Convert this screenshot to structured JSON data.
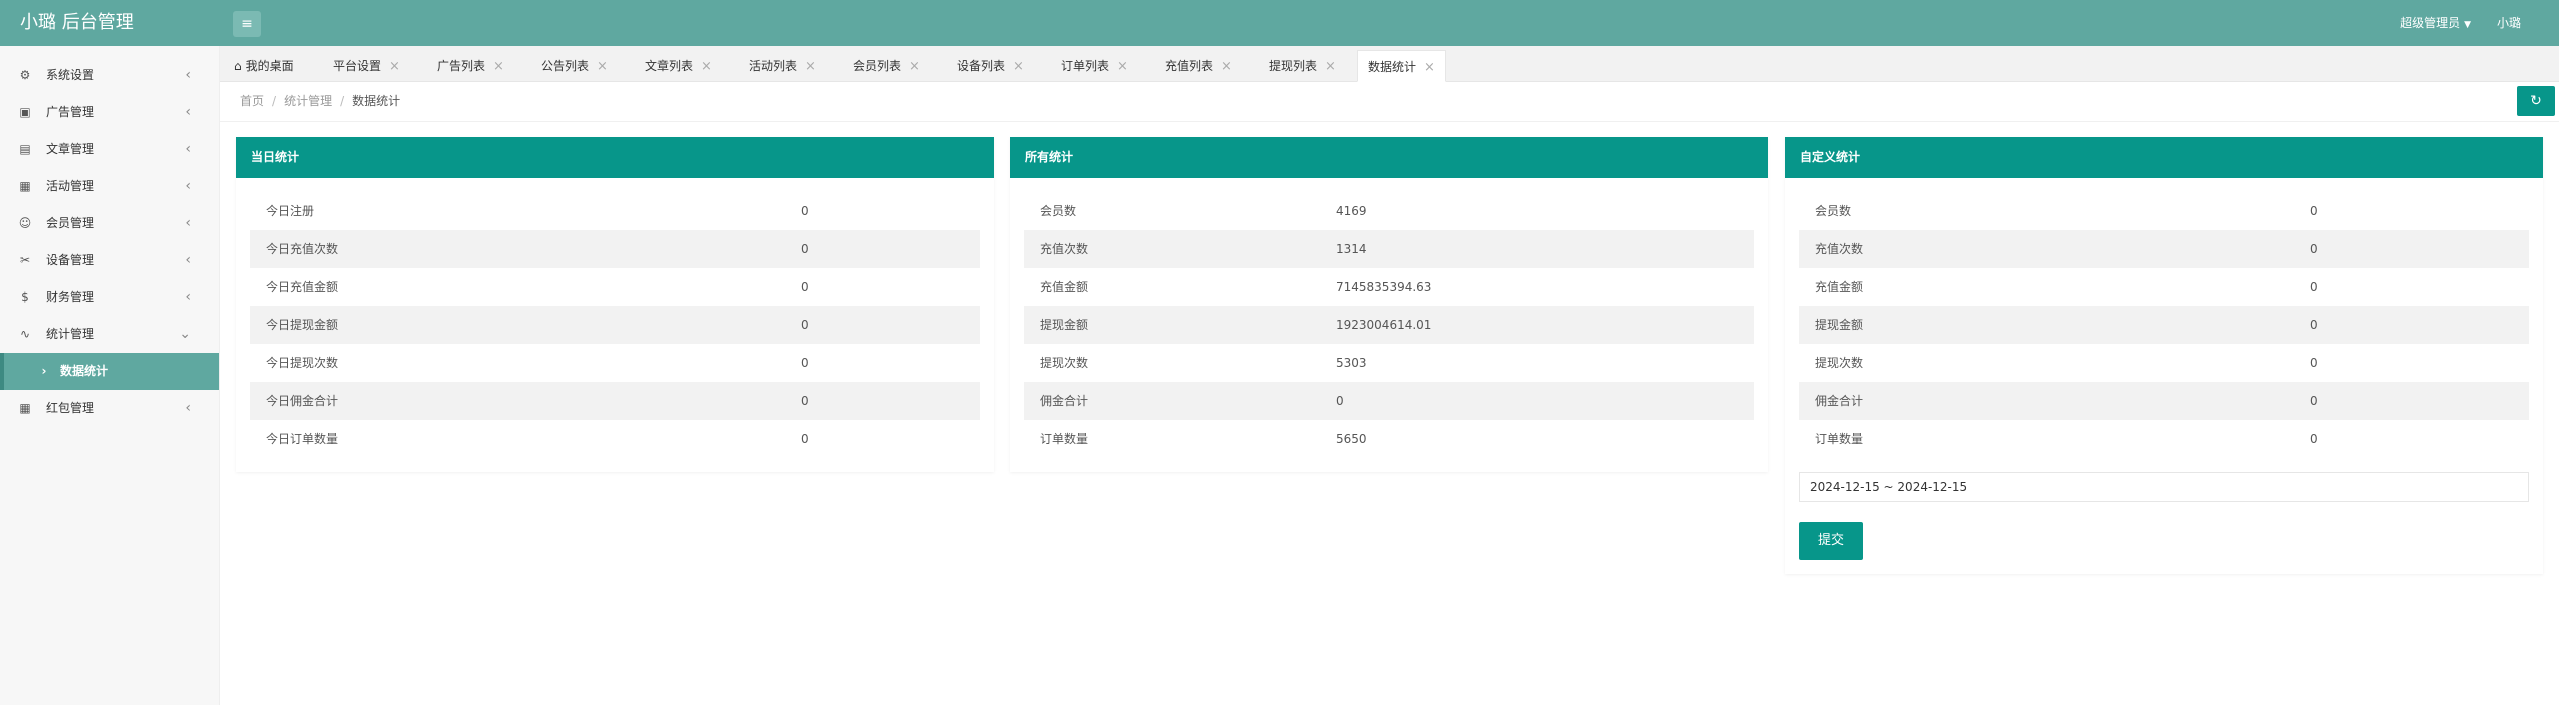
{
  "header": {
    "logo": "小璐 后台管理",
    "menu_toggle_icon": "hamburger-icon",
    "user_role": "超级管理员",
    "user_name": "小璐"
  },
  "sidebar": {
    "items": [
      {
        "label": "系统设置",
        "icon": "gear-icon"
      },
      {
        "label": "广告管理",
        "icon": "image-icon"
      },
      {
        "label": "文章管理",
        "icon": "book-icon"
      },
      {
        "label": "活动管理",
        "icon": "calendar-icon"
      },
      {
        "label": "会员管理",
        "icon": "user-icon"
      },
      {
        "label": "设备管理",
        "icon": "device-icon"
      },
      {
        "label": "财务管理",
        "icon": "money-icon"
      },
      {
        "label": "统计管理",
        "icon": "stats-icon"
      },
      {
        "label": "数据统计",
        "icon": "chevron-right-icon"
      },
      {
        "label": "红包管理",
        "icon": "gift-icon"
      }
    ]
  },
  "tabs": [
    {
      "label": "我的桌面"
    },
    {
      "label": "平台设置"
    },
    {
      "label": "广告列表"
    },
    {
      "label": "公告列表"
    },
    {
      "label": "文章列表"
    },
    {
      "label": "活动列表"
    },
    {
      "label": "会员列表"
    },
    {
      "label": "设备列表"
    },
    {
      "label": "订单列表"
    },
    {
      "label": "充值列表"
    },
    {
      "label": "提现列表"
    },
    {
      "label": "数据统计"
    }
  ],
  "breadcrumb": [
    "首页",
    "统计管理",
    "数据统计"
  ],
  "panels": {
    "today": {
      "title": "当日统计",
      "rows": [
        {
          "k": "今日注册",
          "v": "0"
        },
        {
          "k": "今日充值次数",
          "v": "0"
        },
        {
          "k": "今日充值金额",
          "v": "0"
        },
        {
          "k": "今日提现金额",
          "v": "0"
        },
        {
          "k": "今日提现次数",
          "v": "0"
        },
        {
          "k": "今日佣金合计",
          "v": "0"
        },
        {
          "k": "今日订单数量",
          "v": "0"
        }
      ]
    },
    "all": {
      "title": "所有统计",
      "rows": [
        {
          "k": "会员数",
          "v": "4169"
        },
        {
          "k": "充值次数",
          "v": "1314"
        },
        {
          "k": "充值金额",
          "v": "7145835394.63"
        },
        {
          "k": "提现金额",
          "v": "1923004614.01"
        },
        {
          "k": "提现次数",
          "v": "5303"
        },
        {
          "k": "佣金合计",
          "v": "0"
        },
        {
          "k": "订单数量",
          "v": "5650"
        }
      ]
    },
    "custom": {
      "title": "自定义统计",
      "rows": [
        {
          "k": "会员数",
          "v": "0"
        },
        {
          "k": "充值次数",
          "v": "0"
        },
        {
          "k": "充值金额",
          "v": "0"
        },
        {
          "k": "提现金额",
          "v": "0"
        },
        {
          "k": "提现次数",
          "v": "0"
        },
        {
          "k": "佣金合计",
          "v": "0"
        },
        {
          "k": "订单数量",
          "v": "0"
        }
      ],
      "date_range": "2024-12-15 ~ 2024-12-15",
      "submit_label": "提交"
    }
  },
  "colors": {
    "header": "#5fa8a0",
    "panel_head": "#07968a",
    "button": "#07968a"
  }
}
